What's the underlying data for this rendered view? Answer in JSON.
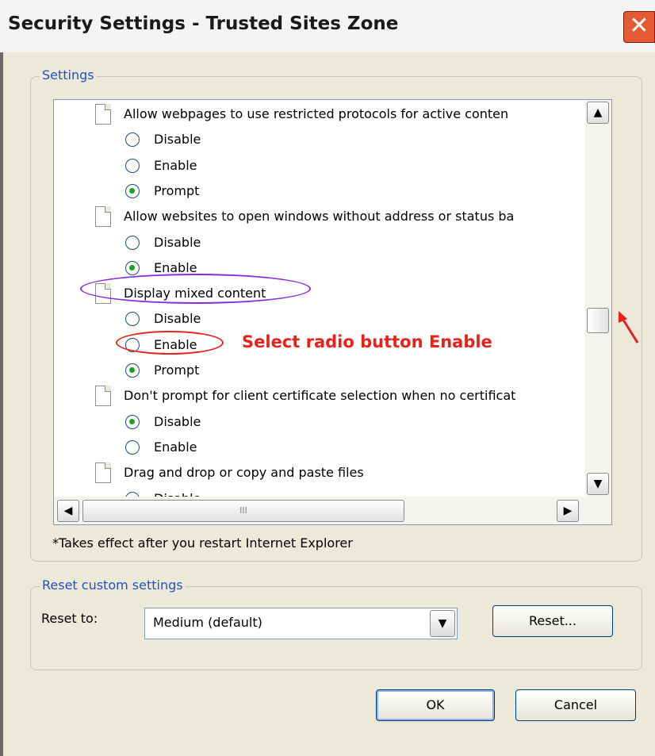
{
  "window": {
    "title": "Security Settings - Trusted Sites Zone",
    "close_glyph": "✕"
  },
  "settings_group": {
    "label": "Settings",
    "list": [
      {
        "type": "item",
        "label": "Allow webpages to use restricted protocols for active conten"
      },
      {
        "type": "option",
        "label": "Disable",
        "checked": false
      },
      {
        "type": "option",
        "label": "Enable",
        "checked": false
      },
      {
        "type": "option",
        "label": "Prompt",
        "checked": true
      },
      {
        "type": "item",
        "label": "Allow websites to open windows without address or status ba"
      },
      {
        "type": "option",
        "label": "Disable",
        "checked": false
      },
      {
        "type": "option",
        "label": "Enable",
        "checked": true
      },
      {
        "type": "item",
        "label": "Display mixed content"
      },
      {
        "type": "option",
        "label": "Disable",
        "checked": false
      },
      {
        "type": "option",
        "label": "Enable",
        "checked": false
      },
      {
        "type": "option",
        "label": "Prompt",
        "checked": true
      },
      {
        "type": "item",
        "label": "Don't prompt for client certificate selection when no certificat"
      },
      {
        "type": "option",
        "label": "Disable",
        "checked": true
      },
      {
        "type": "option",
        "label": "Enable",
        "checked": false
      },
      {
        "type": "item",
        "label": "Drag and drop or copy and paste files"
      },
      {
        "type": "option",
        "label": "Disable",
        "checked": false
      }
    ],
    "footnote": "*Takes effect after you restart Internet Explorer"
  },
  "scrollbars": {
    "up_glyph": "▲",
    "down_glyph": "▼",
    "left_glyph": "◀",
    "right_glyph": "▶",
    "grip_glyph": "III"
  },
  "annotation": {
    "text": "Select radio button Enable",
    "color": "#e8211a"
  },
  "reset_group": {
    "label": "Reset custom settings",
    "reset_to_label": "Reset to:",
    "selected_level": "Medium (default)",
    "dropdown_glyph": "▼",
    "reset_button": "Reset..."
  },
  "buttons": {
    "ok": "OK",
    "cancel": "Cancel"
  }
}
